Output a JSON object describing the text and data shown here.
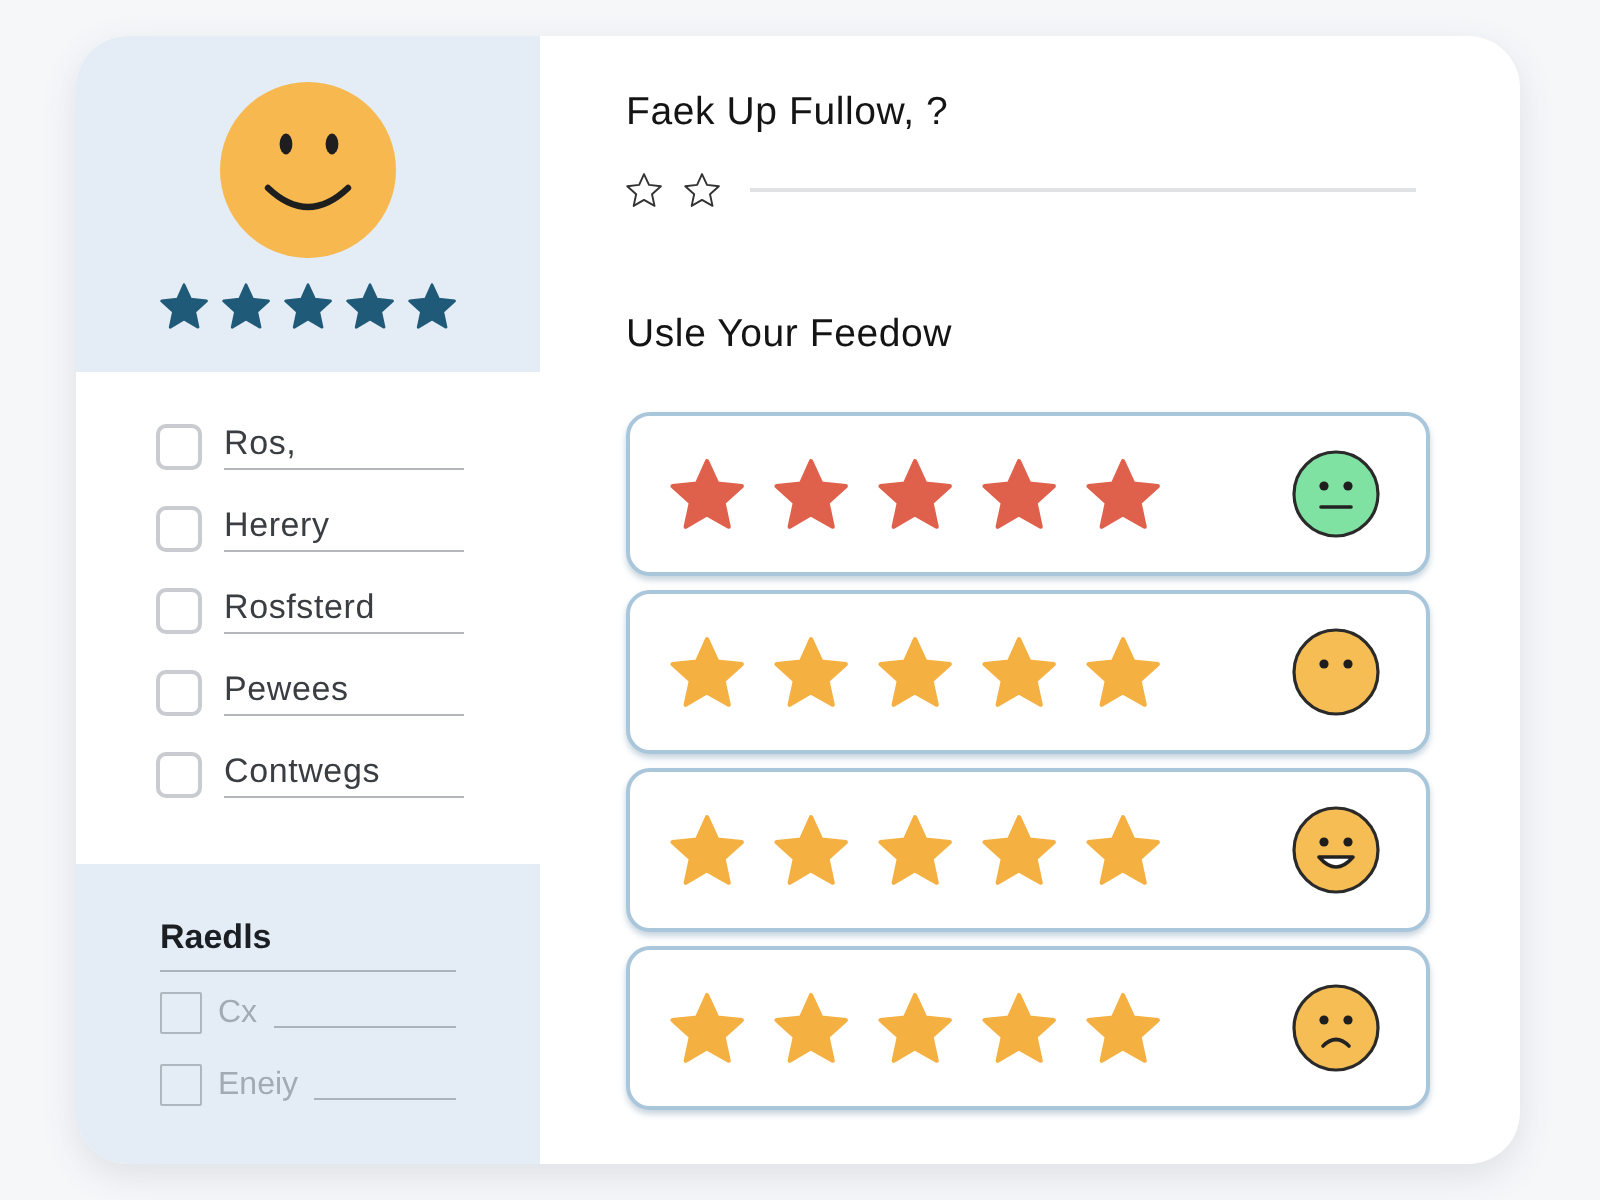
{
  "sidebar": {
    "stars": 5,
    "checklist": [
      {
        "label": "Ros,",
        "checked": false
      },
      {
        "label": "Herery",
        "checked": false
      },
      {
        "label": "Rosfsterd",
        "checked": false
      },
      {
        "label": "Pewees",
        "checked": false
      },
      {
        "label": "Contwegs",
        "checked": false
      }
    ],
    "section": {
      "title": "Raedls",
      "items": [
        {
          "label": "Cx",
          "checked": false
        },
        {
          "label": "Eneiy",
          "checked": false
        }
      ]
    }
  },
  "main": {
    "title": "Faek Up Fullow, ?",
    "subtitle": "Usle Your Feedow",
    "ratings": [
      {
        "stars": 5,
        "color": "#df604b",
        "face": {
          "kind": "neutral",
          "color": "#80e2a2"
        }
      },
      {
        "stars": 5,
        "color": "#f4b142",
        "face": {
          "kind": "blank",
          "color": "#f6bd55"
        }
      },
      {
        "stars": 5,
        "color": "#f4b142",
        "face": {
          "kind": "grin",
          "color": "#f6bd55"
        }
      },
      {
        "stars": 5,
        "color": "#f4b142",
        "face": {
          "kind": "frown",
          "color": "#f6bd55"
        }
      }
    ]
  }
}
